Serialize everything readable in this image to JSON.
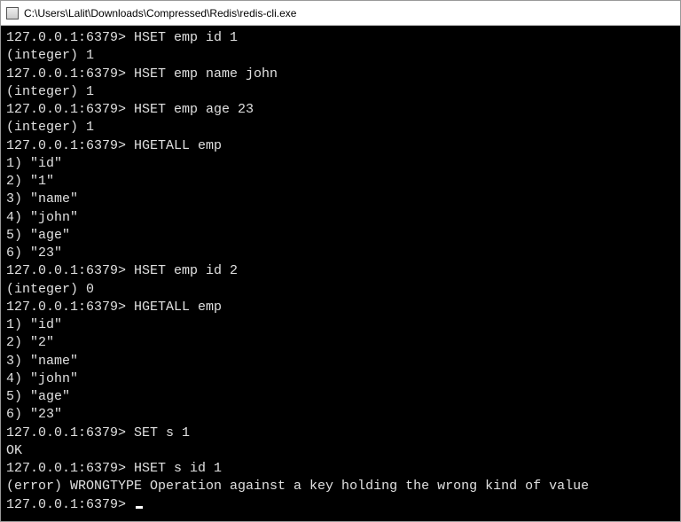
{
  "window": {
    "title": "C:\\Users\\Lalit\\Downloads\\Compressed\\Redis\\redis-cli.exe"
  },
  "prompt": "127.0.0.1:6379>",
  "lines": [
    {
      "type": "cmd",
      "text": "HSET emp id 1"
    },
    {
      "type": "out",
      "text": "(integer) 1"
    },
    {
      "type": "cmd",
      "text": "HSET emp name john"
    },
    {
      "type": "out",
      "text": "(integer) 1"
    },
    {
      "type": "cmd",
      "text": "HSET emp age 23"
    },
    {
      "type": "out",
      "text": "(integer) 1"
    },
    {
      "type": "cmd",
      "text": "HGETALL emp"
    },
    {
      "type": "out",
      "text": "1) \"id\""
    },
    {
      "type": "out",
      "text": "2) \"1\""
    },
    {
      "type": "out",
      "text": "3) \"name\""
    },
    {
      "type": "out",
      "text": "4) \"john\""
    },
    {
      "type": "out",
      "text": "5) \"age\""
    },
    {
      "type": "out",
      "text": "6) \"23\""
    },
    {
      "type": "cmd",
      "text": "HSET emp id 2"
    },
    {
      "type": "out",
      "text": "(integer) 0"
    },
    {
      "type": "cmd",
      "text": "HGETALL emp"
    },
    {
      "type": "out",
      "text": "1) \"id\""
    },
    {
      "type": "out",
      "text": "2) \"2\""
    },
    {
      "type": "out",
      "text": "3) \"name\""
    },
    {
      "type": "out",
      "text": "4) \"john\""
    },
    {
      "type": "out",
      "text": "5) \"age\""
    },
    {
      "type": "out",
      "text": "6) \"23\""
    },
    {
      "type": "cmd",
      "text": "SET s 1"
    },
    {
      "type": "out",
      "text": "OK"
    },
    {
      "type": "cmd",
      "text": "HSET s id 1"
    },
    {
      "type": "out",
      "text": "(error) WRONGTYPE Operation against a key holding the wrong kind of value"
    },
    {
      "type": "prompt-only"
    }
  ]
}
